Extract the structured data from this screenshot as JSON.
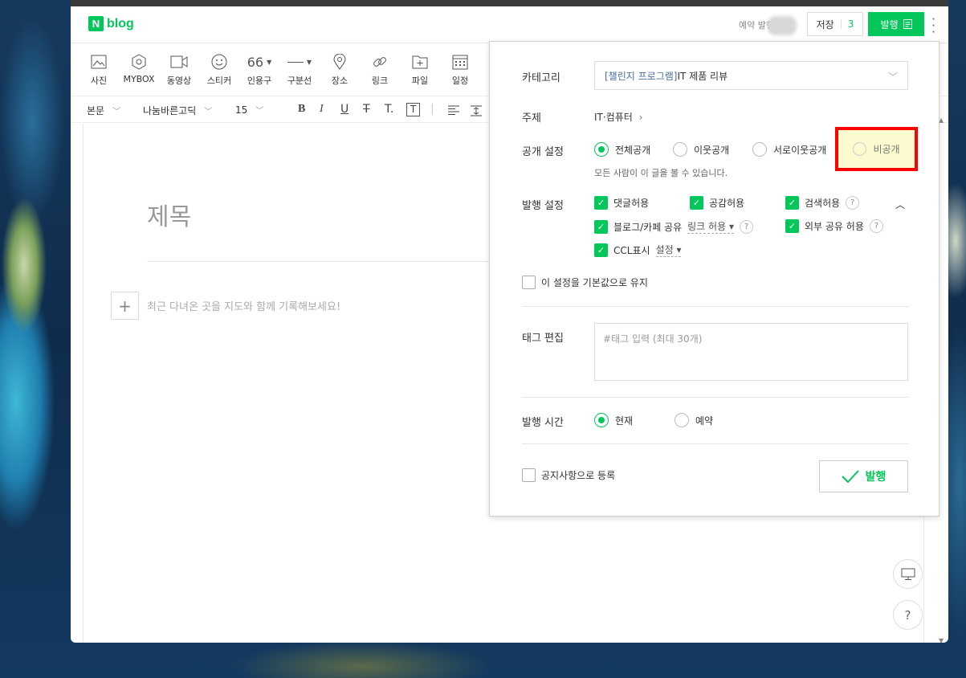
{
  "header": {
    "logo_n": "N",
    "logo_text": "blog",
    "reserve_label": "예약 발행",
    "save_label": "저장",
    "save_count": "3",
    "publish_label": "발행"
  },
  "toolbar": {
    "items": [
      {
        "label": "사진",
        "icon": "image-icon"
      },
      {
        "label": "MYBOX",
        "icon": "mybox-icon"
      },
      {
        "label": "동영상",
        "icon": "video-icon"
      },
      {
        "label": "스티커",
        "icon": "sticker-icon"
      },
      {
        "label": "인용구",
        "icon": "quote-icon"
      },
      {
        "label": "구분선",
        "icon": "divider-icon"
      },
      {
        "label": "장소",
        "icon": "location-icon"
      },
      {
        "label": "링크",
        "icon": "link-icon"
      },
      {
        "label": "파일",
        "icon": "file-icon"
      },
      {
        "label": "일정",
        "icon": "calendar-icon"
      }
    ],
    "format": {
      "paragraph": "본문",
      "font": "나눔바른고딕",
      "size": "15"
    }
  },
  "editor": {
    "title_placeholder": "제목",
    "body_placeholder": "최근 다녀온 곳을 지도와 함께 기록해보세요!"
  },
  "panel": {
    "category_label": "카테고리",
    "category_prefix": "[챌린지 프로그램]",
    "category_value": "IT 제품 리뷰",
    "topic_label": "주제",
    "topic_value": "IT·컴퓨터",
    "visibility_label": "공개 설정",
    "visibility_options": [
      "전체공개",
      "이웃공개",
      "서로이웃공개",
      "비공개"
    ],
    "visibility_hint": "모든 사람이 이 글을 볼 수 있습니다.",
    "publish_settings_label": "발행 설정",
    "opt_comment": "댓글허용",
    "opt_like": "공감허용",
    "opt_search": "검색허용",
    "opt_share": "블로그/카페 공유",
    "opt_share_sub": "링크 허용",
    "opt_external": "외부 공유 허용",
    "opt_ccl": "CCL표시",
    "opt_ccl_sub": "설정",
    "keep_default": "이 설정을 기본값으로 유지",
    "tag_label": "태그 편집",
    "tag_placeholder": "#태그 입력 (최대 30개)",
    "time_label": "발행 시간",
    "time_now": "현재",
    "time_reserve": "예약",
    "notice": "공지사항으로 등록",
    "publish_button": "발행"
  },
  "colors": {
    "accent": "#03c75a",
    "highlight_border": "#ff0000",
    "highlight_fill": "#fcfbd0"
  }
}
